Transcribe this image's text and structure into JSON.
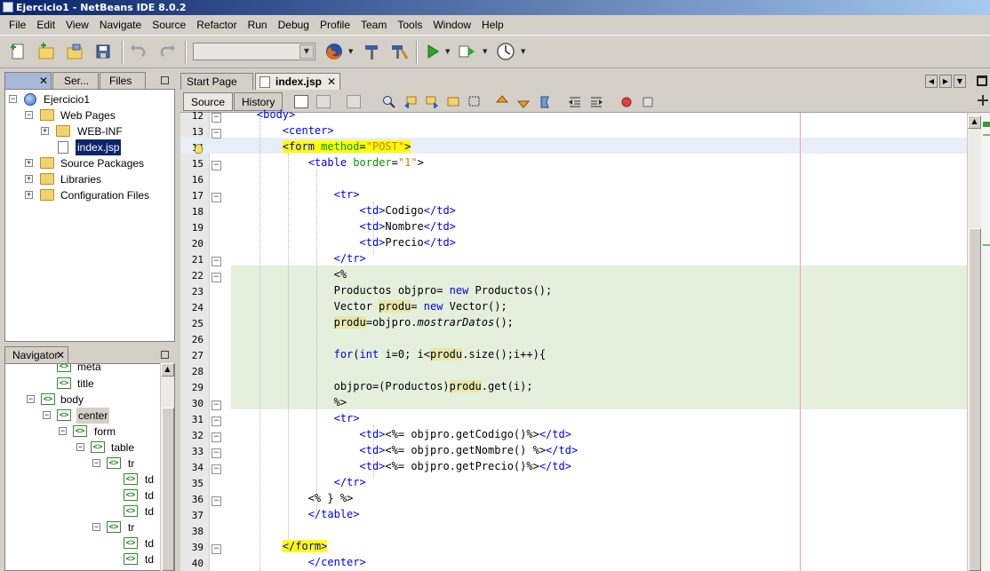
{
  "window": {
    "title": "Ejercicio1 - NetBeans IDE 8.0.2"
  },
  "menu": [
    "File",
    "Edit",
    "View",
    "Navigate",
    "Source",
    "Refactor",
    "Run",
    "Debug",
    "Profile",
    "Team",
    "Tools",
    "Window",
    "Help"
  ],
  "toolbar": {
    "config_value": ""
  },
  "projects_panel": {
    "tabs": [
      "",
      "Ser...",
      "Files"
    ],
    "tree": [
      {
        "label": "Ejercicio1",
        "icon": "project-globe-icon"
      },
      {
        "label": "Web Pages",
        "icon": "web-folder-icon"
      },
      {
        "label": "WEB-INF",
        "icon": "folder-icon"
      },
      {
        "label": "index.jsp",
        "icon": "jsp-file-icon",
        "selected": true
      },
      {
        "label": "Source Packages",
        "icon": "package-folder-icon"
      },
      {
        "label": "Libraries",
        "icon": "library-folder-icon"
      },
      {
        "label": "Configuration Files",
        "icon": "config-folder-icon"
      }
    ]
  },
  "navigator": {
    "title": "Navigator",
    "tree": [
      "meta",
      "title",
      "body",
      "center",
      "form",
      "table",
      "tr",
      "td",
      "td",
      "td",
      "tr",
      "td",
      "td"
    ]
  },
  "editor": {
    "tabs": [
      "Start Page",
      "index.jsp"
    ],
    "active_tab": "index.jsp",
    "view_buttons": [
      "Source",
      "History"
    ],
    "lines": [
      {
        "n": "12",
        "text": "    <body>"
      },
      {
        "n": "13",
        "text": "        <center>"
      },
      {
        "n": "14",
        "text": "        <form method=\"POST\">"
      },
      {
        "n": "15",
        "text": "            <table border=\"1\">"
      },
      {
        "n": "16",
        "text": ""
      },
      {
        "n": "17",
        "text": "                <tr>"
      },
      {
        "n": "18",
        "text": "                    <td>Codigo</td>"
      },
      {
        "n": "19",
        "text": "                    <td>Nombre</td>"
      },
      {
        "n": "20",
        "text": "                    <td>Precio</td>"
      },
      {
        "n": "21",
        "text": "                </tr>"
      },
      {
        "n": "22",
        "text": "                <%"
      },
      {
        "n": "23",
        "text": "                Productos objpro= new Productos();"
      },
      {
        "n": "24",
        "text": "                Vector produ= new Vector();"
      },
      {
        "n": "25",
        "text": "                produ=objpro.mostrarDatos();"
      },
      {
        "n": "26",
        "text": ""
      },
      {
        "n": "27",
        "text": "                for(int i=0; i<produ.size();i++){"
      },
      {
        "n": "28",
        "text": ""
      },
      {
        "n": "29",
        "text": "                objpro=(Productos)produ.get(i);"
      },
      {
        "n": "30",
        "text": "                %>"
      },
      {
        "n": "31",
        "text": "                <tr>"
      },
      {
        "n": "32",
        "text": "                    <td><%= objpro.getCodigo()%></td>"
      },
      {
        "n": "33",
        "text": "                    <td><%= objpro.getNombre() %></td>"
      },
      {
        "n": "34",
        "text": "                    <td><%= objpro.getPrecio()%></td>"
      },
      {
        "n": "35",
        "text": "                </tr>"
      },
      {
        "n": "36",
        "text": "            <% } %>"
      },
      {
        "n": "37",
        "text": "            </table>"
      },
      {
        "n": "38",
        "text": ""
      },
      {
        "n": "39",
        "text": "        </form>"
      },
      {
        "n": "40",
        "text": "            </center>"
      }
    ]
  },
  "colors": {
    "tag": "#0000e6",
    "attribute": "#009900",
    "string": "#ce7b00",
    "scriptlet_bg": "#e4f0dc",
    "highlight": "#ffff00"
  }
}
